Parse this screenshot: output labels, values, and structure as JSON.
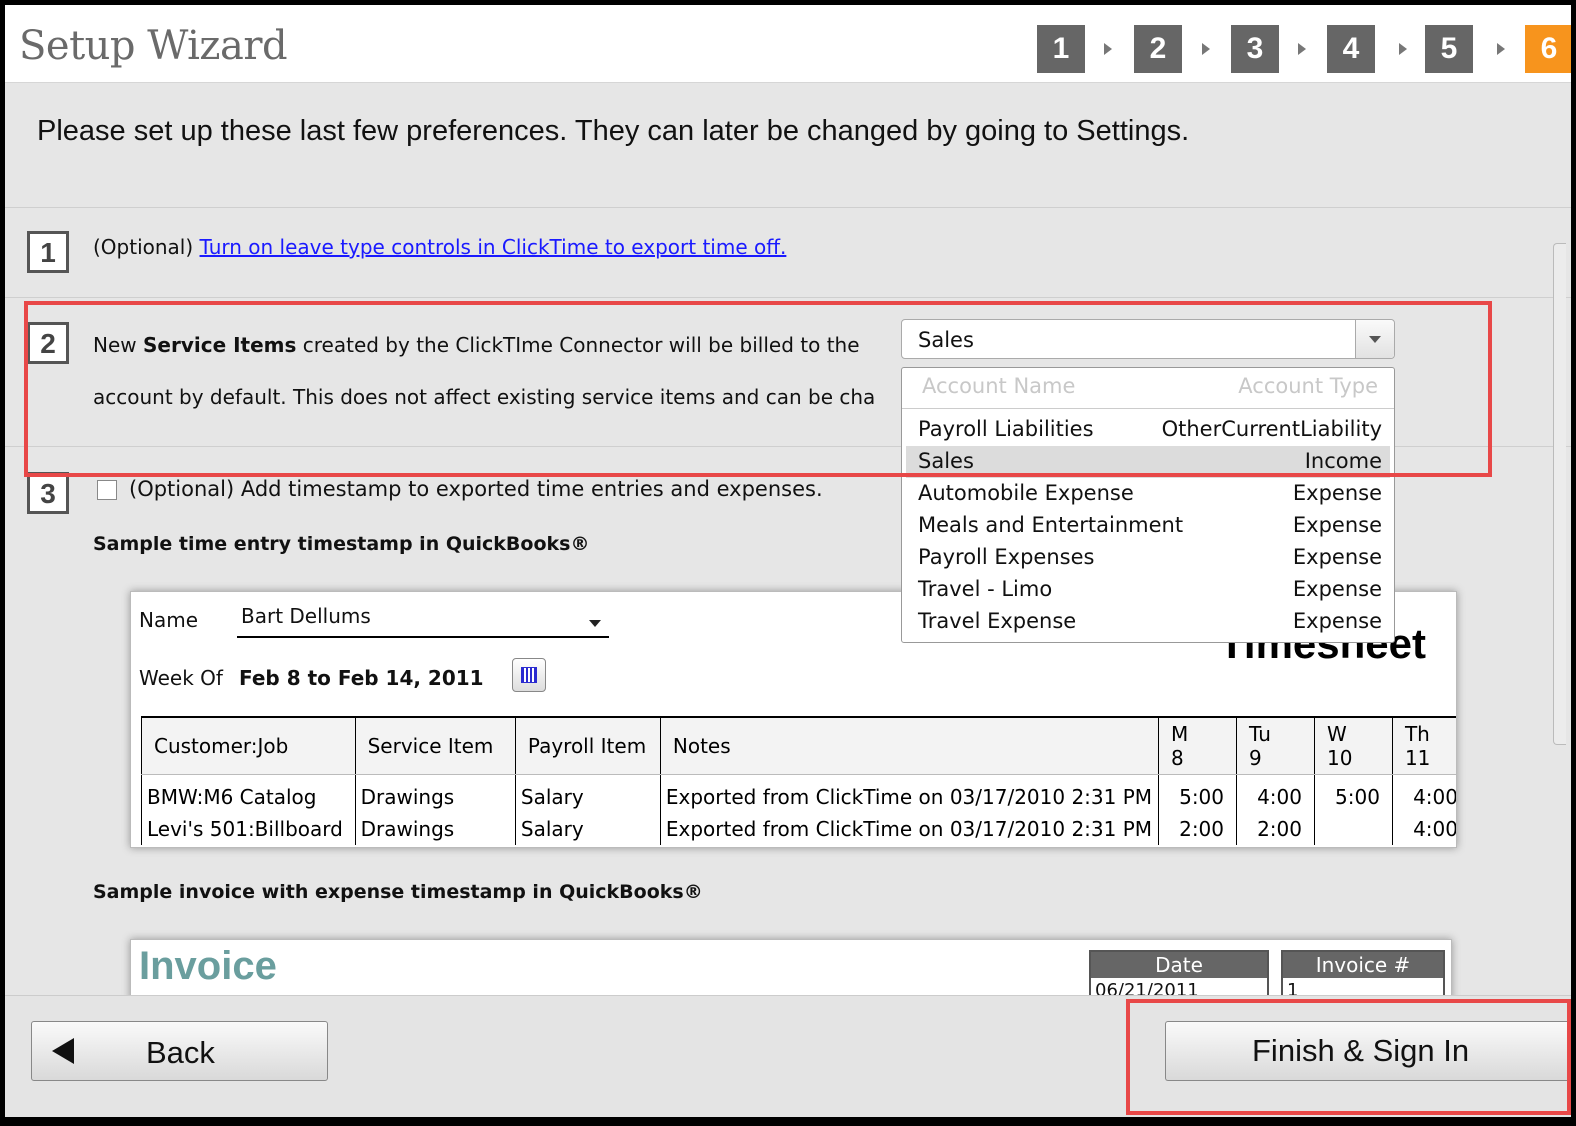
{
  "wizard": {
    "title": "Setup Wizard",
    "steps": [
      "1",
      "2",
      "3",
      "4",
      "5",
      "6"
    ],
    "active_step": "6"
  },
  "intro": "Please set up these last few preferences. They can later be changed by going to Settings.",
  "section1": {
    "number": "1",
    "prefix": "(Optional) ",
    "link": "Turn on leave type controls in ClickTime to export time off."
  },
  "section2": {
    "number": "2",
    "line1_a": "New ",
    "line1_bold": "Service Items",
    "line1_b": " created by the ClickTIme Connector will be billed to the",
    "line2": "account by default. This does not affect existing service items and can be cha",
    "select_value": "Sales",
    "dropdown": {
      "header_name": "Account Name",
      "header_type": "Account Type",
      "rows": [
        {
          "name": "Payroll Liabilities",
          "type": "OtherCurrentLiability"
        },
        {
          "name": "Sales",
          "type": "Income"
        },
        {
          "name": "Automobile Expense",
          "type": "Expense"
        },
        {
          "name": "Meals and Entertainment",
          "type": "Expense"
        },
        {
          "name": "Payroll Expenses",
          "type": "Expense"
        },
        {
          "name": "Travel - Limo",
          "type": "Expense"
        },
        {
          "name": "Travel Expense",
          "type": "Expense"
        }
      ]
    }
  },
  "section3": {
    "number": "3",
    "checkbox_label": "(Optional) Add timestamp to exported time entries and expenses.",
    "sample_time_caption": "Sample time entry timestamp in QuickBooks®",
    "sample_invoice_caption": "Sample invoice with expense timestamp in QuickBooks®"
  },
  "timesheet": {
    "title": "Timesheet",
    "name_label": "Name",
    "name_value": "Bart Dellums",
    "week_label": "Week Of",
    "week_value": "Feb 8 to Feb 14, 2011",
    "columns": [
      "Customer:Job",
      "Service Item",
      "Payroll Item",
      "Notes"
    ],
    "day_columns": [
      {
        "day": "M",
        "date": "8"
      },
      {
        "day": "Tu",
        "date": "9"
      },
      {
        "day": "W",
        "date": "10"
      },
      {
        "day": "Th",
        "date": "11"
      }
    ],
    "rows": [
      {
        "job": "BMW:M6 Catalog",
        "service": "Drawings",
        "payroll": "Salary",
        "notes": "Exported from ClickTime on 03/17/2010 2:31 PM",
        "m": "5:00",
        "tu": "4:00",
        "w": "5:00",
        "th": "4:00"
      },
      {
        "job": "Levi's 501:Billboard",
        "service": "Drawings",
        "payroll": "Salary",
        "notes": "Exported from ClickTime on 03/17/2010 2:31 PM",
        "m": "2:00",
        "tu": "2:00",
        "w": "",
        "th": "4:00"
      }
    ]
  },
  "invoice": {
    "title": "Invoice",
    "date_label": "Date",
    "date_value": "06/21/2011",
    "number_label": "Invoice #",
    "number_value": "1"
  },
  "buttons": {
    "back": "Back",
    "finish": "Finish & Sign In"
  },
  "colors": {
    "active_step": "#f7941d",
    "step": "#666666",
    "highlight": "#e84848",
    "link": "#1a1aff"
  }
}
